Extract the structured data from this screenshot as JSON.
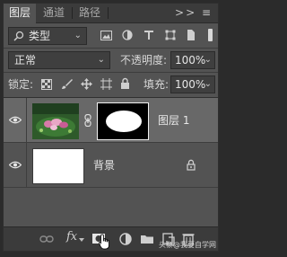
{
  "tabs": [
    {
      "label": "图层",
      "active": true
    },
    {
      "label": "通道",
      "active": false
    },
    {
      "label": "路径",
      "active": false
    }
  ],
  "panel_controls": ">> ≡",
  "filter": {
    "label": "类型"
  },
  "blend_mode": {
    "value": "正常"
  },
  "opacity": {
    "label": "不透明度:",
    "value": "100%"
  },
  "lock": {
    "label": "锁定:"
  },
  "fill": {
    "label": "填充:",
    "value": "100%"
  },
  "layers": [
    {
      "name": "图层 1",
      "selected": true,
      "has_mask": true
    },
    {
      "name": "背景",
      "selected": false,
      "locked": true
    }
  ],
  "bottom_bar": {
    "fx_label": "fx",
    "watermark": "头条@我要自学网"
  },
  "colors": {
    "panel": "#535353",
    "selected_layer": "#686868",
    "bar": "#3b3b3b"
  }
}
